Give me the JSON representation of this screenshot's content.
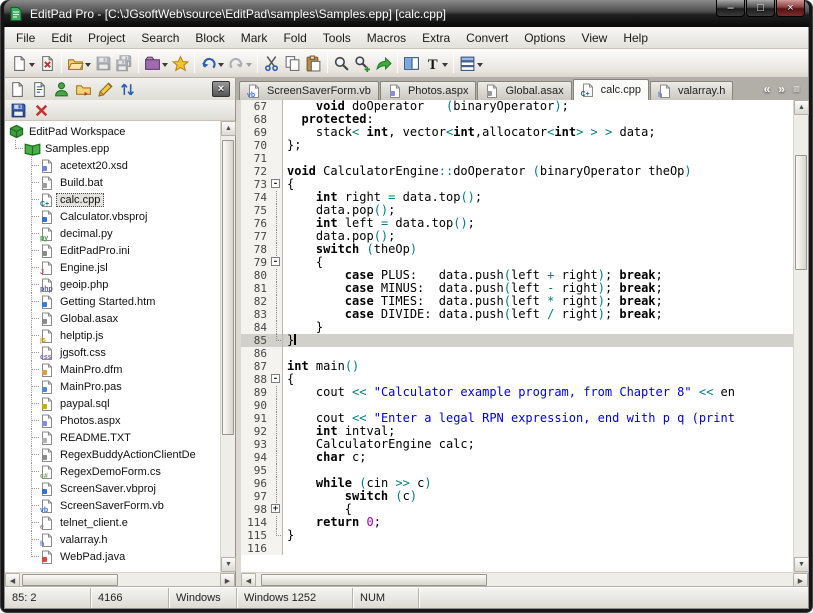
{
  "window": {
    "title": "EditPad Pro - [C:\\JGsoftWeb\\source\\EditPad\\samples\\Samples.epp] [calc.cpp]",
    "controls": [
      {
        "name": "minimize",
        "glyph": "–"
      },
      {
        "name": "maximize",
        "glyph": "□"
      },
      {
        "name": "close",
        "glyph": "×"
      }
    ]
  },
  "menu": {
    "items": [
      "File",
      "Edit",
      "Project",
      "Search",
      "Block",
      "Mark",
      "Fold",
      "Tools",
      "Macros",
      "Extra",
      "Convert",
      "Options",
      "View",
      "Help"
    ]
  },
  "toolbar": {
    "buttons": [
      {
        "icon": "new-file",
        "dropdown": true
      },
      {
        "icon": "close-file"
      },
      {
        "sep": true
      },
      {
        "icon": "open-folder",
        "dropdown": true
      },
      {
        "icon": "save",
        "disabled": true
      },
      {
        "icon": "save-all",
        "disabled": true
      },
      {
        "sep": true
      },
      {
        "icon": "project-folder",
        "dropdown": true
      },
      {
        "icon": "favorites"
      },
      {
        "sep": true
      },
      {
        "icon": "undo",
        "dropdown": true
      },
      {
        "icon": "redo",
        "dropdown": true,
        "disabled": true
      },
      {
        "sep": true
      },
      {
        "icon": "cut"
      },
      {
        "icon": "copy"
      },
      {
        "icon": "paste"
      },
      {
        "sep": true
      },
      {
        "icon": "search"
      },
      {
        "icon": "search-next"
      },
      {
        "icon": "go-to"
      },
      {
        "sep": true
      },
      {
        "icon": "split-view"
      },
      {
        "icon": "text-format",
        "dropdown": true
      },
      {
        "sep": true
      },
      {
        "icon": "browse-files",
        "dropdown": true
      }
    ]
  },
  "panel_toolbar": {
    "buttons": [
      {
        "icon": "new-file"
      },
      {
        "icon": "view-tree"
      },
      {
        "icon": "user"
      },
      {
        "icon": "open-project"
      },
      {
        "icon": "edit"
      },
      {
        "icon": "sort"
      }
    ],
    "close_glyph": "×"
  },
  "files_toolbar": {
    "buttons": [
      {
        "icon": "save-file"
      },
      {
        "icon": "close-red"
      }
    ]
  },
  "tabs": {
    "items": [
      {
        "label": "ScreenSaverForm.vb",
        "badge": "vb",
        "color": "#3a6fd8"
      },
      {
        "label": "Photos.aspx",
        "badge": "",
        "color": "#8a8ad8"
      },
      {
        "label": "Global.asax",
        "badge": "",
        "color": "#9a9a9a"
      },
      {
        "label": "calc.cpp",
        "badge": "C+",
        "color": "#007c7c",
        "active": true
      },
      {
        "label": "valarray.h",
        "badge": "h",
        "color": "#5a7ad8"
      }
    ],
    "nav": [
      {
        "name": "scroll-tabs-left",
        "glyph": "«"
      },
      {
        "name": "scroll-tabs-right",
        "glyph": "»"
      },
      {
        "name": "tab-list",
        "glyph": "≡"
      }
    ]
  },
  "tree": {
    "items": [
      {
        "label": "EditPad Workspace",
        "icon": "workspace",
        "guides": []
      },
      {
        "label": "Samples.epp",
        "icon": "project",
        "guides": [
          "l"
        ]
      },
      {
        "label": "acetext20.xsd",
        "badge": "",
        "color": "#6f86d6",
        "guides": [
          "x",
          "b"
        ]
      },
      {
        "label": "Build.bat",
        "badge": "",
        "color": "#9a9a9a",
        "guides": [
          "x",
          "b"
        ]
      },
      {
        "label": "calc.cpp",
        "badge": "C+",
        "color": "#007c7c",
        "selected": true,
        "guides": [
          "x",
          "b"
        ]
      },
      {
        "label": "Calculator.vbsproj",
        "badge": "",
        "color": "#3a6fd8",
        "guides": [
          "x",
          "b"
        ]
      },
      {
        "label": "decimal.py",
        "badge": "py",
        "color": "#3a9a3a",
        "guides": [
          "x",
          "b"
        ]
      },
      {
        "label": "EditPadPro.ini",
        "badge": "",
        "color": "#8a8a8a",
        "guides": [
          "x",
          "b"
        ]
      },
      {
        "label": "Engine.jsl",
        "badge": "J",
        "color": "#b05050",
        "guides": [
          "x",
          "b"
        ]
      },
      {
        "label": "geoip.php",
        "badge": "php",
        "color": "#5a5a9a",
        "guides": [
          "x",
          "b"
        ]
      },
      {
        "label": "Getting Started.htm",
        "badge": "",
        "color": "#3a7ad8",
        "guides": [
          "x",
          "b"
        ]
      },
      {
        "label": "Global.asax",
        "badge": "",
        "color": "#8a8a8a",
        "guides": [
          "x",
          "b"
        ]
      },
      {
        "label": "helptip.js",
        "badge": "js",
        "color": "#c8a000",
        "guides": [
          "x",
          "b"
        ]
      },
      {
        "label": "jgsoft.css",
        "badge": "css",
        "color": "#7a5caa",
        "guides": [
          "x",
          "b"
        ]
      },
      {
        "label": "MainPro.dfm",
        "badge": "",
        "color": "#d8a040",
        "guides": [
          "x",
          "b"
        ]
      },
      {
        "label": "MainPro.pas",
        "badge": "",
        "color": "#4a8ad8",
        "guides": [
          "x",
          "b"
        ]
      },
      {
        "label": "paypal.sql",
        "badge": "",
        "color": "#c8b000",
        "guides": [
          "x",
          "b"
        ]
      },
      {
        "label": "Photos.aspx",
        "badge": "",
        "color": "#8a8ad8",
        "guides": [
          "x",
          "b"
        ]
      },
      {
        "label": "README.TXT",
        "badge": "",
        "color": "#b0b0b0",
        "guides": [
          "x",
          "b"
        ]
      },
      {
        "label": "RegexBuddyActionClientDe",
        "badge": "",
        "color": "#8a8a8a",
        "guides": [
          "x",
          "b"
        ]
      },
      {
        "label": "RegexDemoForm.cs",
        "badge": "c#",
        "color": "#7aa05a",
        "guides": [
          "x",
          "b"
        ]
      },
      {
        "label": "ScreenSaver.vbproj",
        "badge": "",
        "color": "#3a6fd8",
        "guides": [
          "x",
          "b"
        ]
      },
      {
        "label": "ScreenSaverForm.vb",
        "badge": "vb",
        "color": "#3a6fd8",
        "guides": [
          "x",
          "b"
        ]
      },
      {
        "label": "telnet_client.e",
        "badge": "e",
        "color": "#8a8a8a",
        "guides": [
          "x",
          "b"
        ]
      },
      {
        "label": "valarray.h",
        "badge": "h",
        "color": "#5a7ad8",
        "guides": [
          "x",
          "b"
        ]
      },
      {
        "label": "WebPad.java",
        "badge": "",
        "color": "#d84a3a",
        "guides": [
          "x",
          "l"
        ]
      }
    ]
  },
  "editor": {
    "current_line": 85,
    "lines": [
      {
        "n": 67,
        "fold": null,
        "segs": [
          [
            "d",
            "    "
          ],
          [
            "k",
            "void"
          ],
          [
            "d",
            " doOperator   "
          ],
          [
            "o",
            "("
          ],
          [
            "d",
            "binaryOperator"
          ],
          [
            "o",
            ")"
          ],
          [
            "d",
            ";"
          ]
        ]
      },
      {
        "n": 68,
        "fold": null,
        "segs": [
          [
            "d",
            "  "
          ],
          [
            "k",
            "protected"
          ],
          [
            "d",
            ":"
          ]
        ]
      },
      {
        "n": 69,
        "fold": null,
        "segs": [
          [
            "d",
            "    stack"
          ],
          [
            "o",
            "<"
          ],
          [
            "d",
            " "
          ],
          [
            "k",
            "int"
          ],
          [
            "d",
            ", vector"
          ],
          [
            "o",
            "<"
          ],
          [
            "k",
            "int"
          ],
          [
            "d",
            ",allocator"
          ],
          [
            "o",
            "<"
          ],
          [
            "k",
            "int"
          ],
          [
            "o",
            ">"
          ],
          [
            "d",
            " "
          ],
          [
            "o",
            ">"
          ],
          [
            "d",
            " "
          ],
          [
            "o",
            ">"
          ],
          [
            "d",
            " data;"
          ]
        ]
      },
      {
        "n": 70,
        "fold": null,
        "segs": [
          [
            "d",
            "};"
          ]
        ]
      },
      {
        "n": 71,
        "fold": null,
        "segs": []
      },
      {
        "n": 72,
        "fold": null,
        "segs": [
          [
            "k",
            "void"
          ],
          [
            "d",
            " CalculatorEngine"
          ],
          [
            "o",
            "::"
          ],
          [
            "d",
            "doOperator "
          ],
          [
            "o",
            "("
          ],
          [
            "d",
            "binaryOperator theOp"
          ],
          [
            "o",
            ")"
          ]
        ]
      },
      {
        "n": 73,
        "fold": "open",
        "segs": [
          [
            "d",
            "{"
          ]
        ]
      },
      {
        "n": 74,
        "fold": "line",
        "segs": [
          [
            "d",
            "    "
          ],
          [
            "k",
            "int"
          ],
          [
            "d",
            " right "
          ],
          [
            "o",
            "="
          ],
          [
            "d",
            " data.top"
          ],
          [
            "o",
            "()"
          ],
          [
            "d",
            ";"
          ]
        ]
      },
      {
        "n": 75,
        "fold": "line",
        "segs": [
          [
            "d",
            "    data.pop"
          ],
          [
            "o",
            "()"
          ],
          [
            "d",
            ";"
          ]
        ]
      },
      {
        "n": 76,
        "fold": "line",
        "segs": [
          [
            "d",
            "    "
          ],
          [
            "k",
            "int"
          ],
          [
            "d",
            " left "
          ],
          [
            "o",
            "="
          ],
          [
            "d",
            " data.top"
          ],
          [
            "o",
            "()"
          ],
          [
            "d",
            ";"
          ]
        ]
      },
      {
        "n": 77,
        "fold": "line",
        "segs": [
          [
            "d",
            "    data.pop"
          ],
          [
            "o",
            "()"
          ],
          [
            "d",
            ";"
          ]
        ]
      },
      {
        "n": 78,
        "fold": "line",
        "segs": [
          [
            "d",
            "    "
          ],
          [
            "k",
            "switch"
          ],
          [
            "d",
            " "
          ],
          [
            "o",
            "("
          ],
          [
            "d",
            "theOp"
          ],
          [
            "o",
            ")"
          ]
        ]
      },
      {
        "n": 79,
        "fold": "open",
        "segs": [
          [
            "d",
            "    {"
          ]
        ]
      },
      {
        "n": 80,
        "fold": "line",
        "segs": [
          [
            "d",
            "        "
          ],
          [
            "k",
            "case"
          ],
          [
            "d",
            " PLUS:   data.push"
          ],
          [
            "o",
            "("
          ],
          [
            "d",
            "left "
          ],
          [
            "o",
            "+"
          ],
          [
            "d",
            " right"
          ],
          [
            "o",
            ")"
          ],
          [
            "d",
            "; "
          ],
          [
            "k",
            "break"
          ],
          [
            "d",
            ";"
          ]
        ]
      },
      {
        "n": 81,
        "fold": "line",
        "segs": [
          [
            "d",
            "        "
          ],
          [
            "k",
            "case"
          ],
          [
            "d",
            " MINUS:  data.push"
          ],
          [
            "o",
            "("
          ],
          [
            "d",
            "left "
          ],
          [
            "o",
            "-"
          ],
          [
            "d",
            " right"
          ],
          [
            "o",
            ")"
          ],
          [
            "d",
            "; "
          ],
          [
            "k",
            "break"
          ],
          [
            "d",
            ";"
          ]
        ]
      },
      {
        "n": 82,
        "fold": "line",
        "segs": [
          [
            "d",
            "        "
          ],
          [
            "k",
            "case"
          ],
          [
            "d",
            " TIMES:  data.push"
          ],
          [
            "o",
            "("
          ],
          [
            "d",
            "left "
          ],
          [
            "o",
            "*"
          ],
          [
            "d",
            " right"
          ],
          [
            "o",
            ")"
          ],
          [
            "d",
            "; "
          ],
          [
            "k",
            "break"
          ],
          [
            "d",
            ";"
          ]
        ]
      },
      {
        "n": 83,
        "fold": "line",
        "segs": [
          [
            "d",
            "        "
          ],
          [
            "k",
            "case"
          ],
          [
            "d",
            " DIVIDE: data.push"
          ],
          [
            "o",
            "("
          ],
          [
            "d",
            "left "
          ],
          [
            "o",
            "/"
          ],
          [
            "d",
            " right"
          ],
          [
            "o",
            ")"
          ],
          [
            "d",
            "; "
          ],
          [
            "k",
            "break"
          ],
          [
            "d",
            ";"
          ]
        ]
      },
      {
        "n": 84,
        "fold": "line",
        "segs": [
          [
            "d",
            "    }"
          ]
        ]
      },
      {
        "n": 85,
        "fold": "end",
        "segs": [
          [
            "d",
            "}"
          ]
        ]
      },
      {
        "n": 86,
        "fold": null,
        "segs": []
      },
      {
        "n": 87,
        "fold": null,
        "segs": [
          [
            "k",
            "int"
          ],
          [
            "d",
            " main"
          ],
          [
            "o",
            "()"
          ]
        ]
      },
      {
        "n": 88,
        "fold": "open",
        "segs": [
          [
            "d",
            "{"
          ]
        ]
      },
      {
        "n": 89,
        "fold": "line",
        "segs": [
          [
            "d",
            "    cout "
          ],
          [
            "o",
            "<<"
          ],
          [
            "d",
            " "
          ],
          [
            "s",
            "\"Calculator example program, from Chapter 8\""
          ],
          [
            "d",
            " "
          ],
          [
            "o",
            "<<"
          ],
          [
            "d",
            " en"
          ]
        ]
      },
      {
        "n": 90,
        "fold": "line",
        "segs": []
      },
      {
        "n": 91,
        "fold": "line",
        "segs": [
          [
            "d",
            "    cout "
          ],
          [
            "o",
            "<<"
          ],
          [
            "d",
            " "
          ],
          [
            "s",
            "\"Enter a legal RPN expression, end with p q (print"
          ]
        ]
      },
      {
        "n": 92,
        "fold": "line",
        "segs": [
          [
            "d",
            "    "
          ],
          [
            "k",
            "int"
          ],
          [
            "d",
            " intval;"
          ]
        ]
      },
      {
        "n": 93,
        "fold": "line",
        "segs": [
          [
            "d",
            "    CalculatorEngine calc;"
          ]
        ]
      },
      {
        "n": 94,
        "fold": "line",
        "segs": [
          [
            "d",
            "    "
          ],
          [
            "k",
            "char"
          ],
          [
            "d",
            " c;"
          ]
        ]
      },
      {
        "n": 95,
        "fold": "line",
        "segs": []
      },
      {
        "n": 96,
        "fold": "line",
        "segs": [
          [
            "d",
            "    "
          ],
          [
            "k",
            "while"
          ],
          [
            "d",
            " "
          ],
          [
            "o",
            "("
          ],
          [
            "d",
            "cin "
          ],
          [
            "o",
            ">>"
          ],
          [
            "d",
            " c"
          ],
          [
            "o",
            ")"
          ]
        ]
      },
      {
        "n": 97,
        "fold": "line",
        "segs": [
          [
            "d",
            "        "
          ],
          [
            "k",
            "switch"
          ],
          [
            "d",
            " "
          ],
          [
            "o",
            "("
          ],
          [
            "d",
            "c"
          ],
          [
            "o",
            ")"
          ]
        ]
      },
      {
        "n": 98,
        "fold": "closed",
        "segs": [
          [
            "d",
            "        {"
          ]
        ]
      },
      {
        "n": 114,
        "fold": "line",
        "segs": [
          [
            "d",
            "    "
          ],
          [
            "k",
            "return"
          ],
          [
            "d",
            " "
          ],
          [
            "n",
            "0"
          ],
          [
            "d",
            ";"
          ]
        ]
      },
      {
        "n": 115,
        "fold": "end",
        "segs": [
          [
            "d",
            "}"
          ]
        ]
      },
      {
        "n": 116,
        "fold": null,
        "segs": []
      }
    ]
  },
  "statusbar": {
    "cells": [
      "85: 2",
      "4166",
      "Windows",
      "Windows 1252",
      "NUM"
    ]
  }
}
